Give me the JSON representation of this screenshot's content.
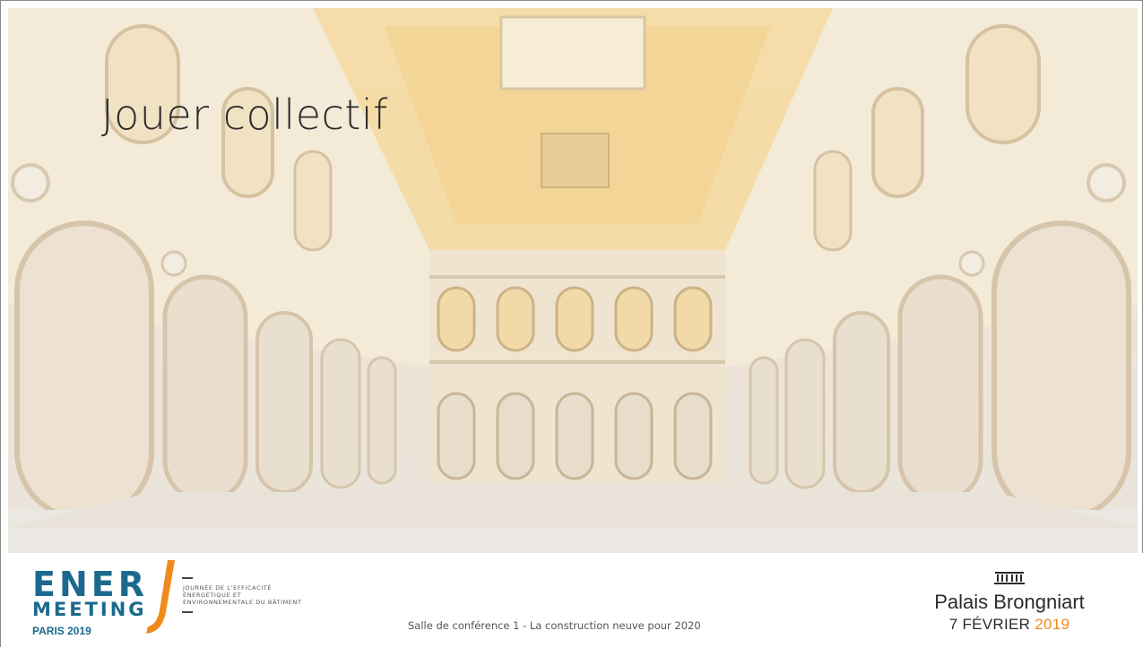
{
  "slide": {
    "title": "Jouer collectif",
    "caption": "Salle de conférence 1 - La construction neuve pour 2020"
  },
  "logo": {
    "ener": "ENER",
    "j": "J",
    "meeting": "MEETING",
    "paris": "PARIS 2019",
    "tagline": "JOURNÉE DE L’EFFICACITÉ ÉNERGÉTIQUE ET ENVIRONNEMENTALE DU BÂTIMENT",
    "colors": {
      "blue": "#1b6a8d",
      "orange": "#f08a1c"
    }
  },
  "venue": {
    "icon": "building-colonnade-icon",
    "name": "Palais Brongniart",
    "date_prefix": "7 FÉVRIER ",
    "date_year": "2019"
  }
}
